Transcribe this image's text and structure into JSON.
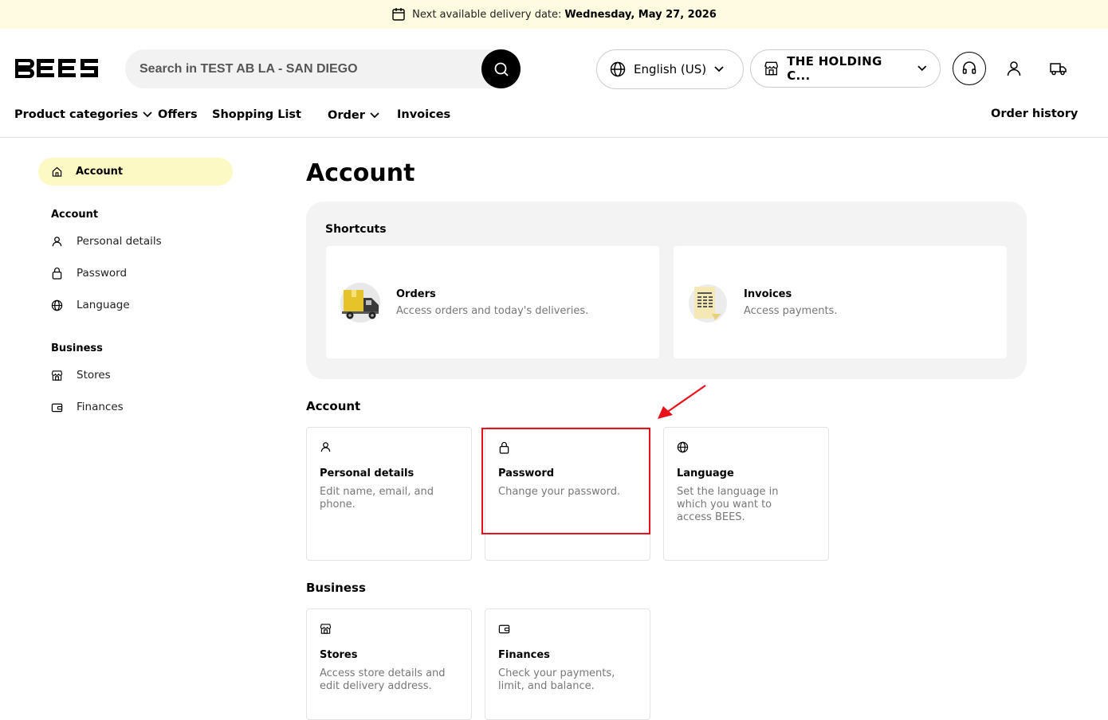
{
  "banner": {
    "label": "Next available delivery date:",
    "date": "Wednesday, May 27, 2026"
  },
  "header": {
    "search_placeholder": "Search in TEST AB LA - SAN DIEGO",
    "language": "English (US)",
    "store": "THE HOLDING C..."
  },
  "nav": {
    "product_categories": "Product categories",
    "offers": "Offers",
    "shopping_list": "Shopping List",
    "order": "Order",
    "invoices": "Invoices",
    "order_history": "Order history"
  },
  "sidebar": {
    "active": "Account",
    "account_heading": "Account",
    "personal_details": "Personal details",
    "password": "Password",
    "language": "Language",
    "business_heading": "Business",
    "stores": "Stores",
    "finances": "Finances"
  },
  "main": {
    "title": "Account",
    "shortcuts": {
      "heading": "Shortcuts",
      "orders_title": "Orders",
      "orders_desc": "Access orders and today's deliveries.",
      "invoices_title": "Invoices",
      "invoices_desc": "Access payments."
    },
    "account_section": {
      "heading": "Account",
      "personal_title": "Personal details",
      "personal_desc": "Edit name, email, and phone.",
      "password_title": "Password",
      "password_desc": "Change your password.",
      "language_title": "Language",
      "language_desc": "Set the language in which you want to access BEES."
    },
    "business_section": {
      "heading": "Business",
      "stores_title": "Stores",
      "stores_desc": "Access store details and edit delivery address.",
      "finances_title": "Finances",
      "finances_desc": "Check your payments, limit, and balance."
    }
  },
  "colors": {
    "accent_yellow": "#fdf9c4",
    "banner": "#fefbe0",
    "highlight_red": "#e8101b"
  }
}
